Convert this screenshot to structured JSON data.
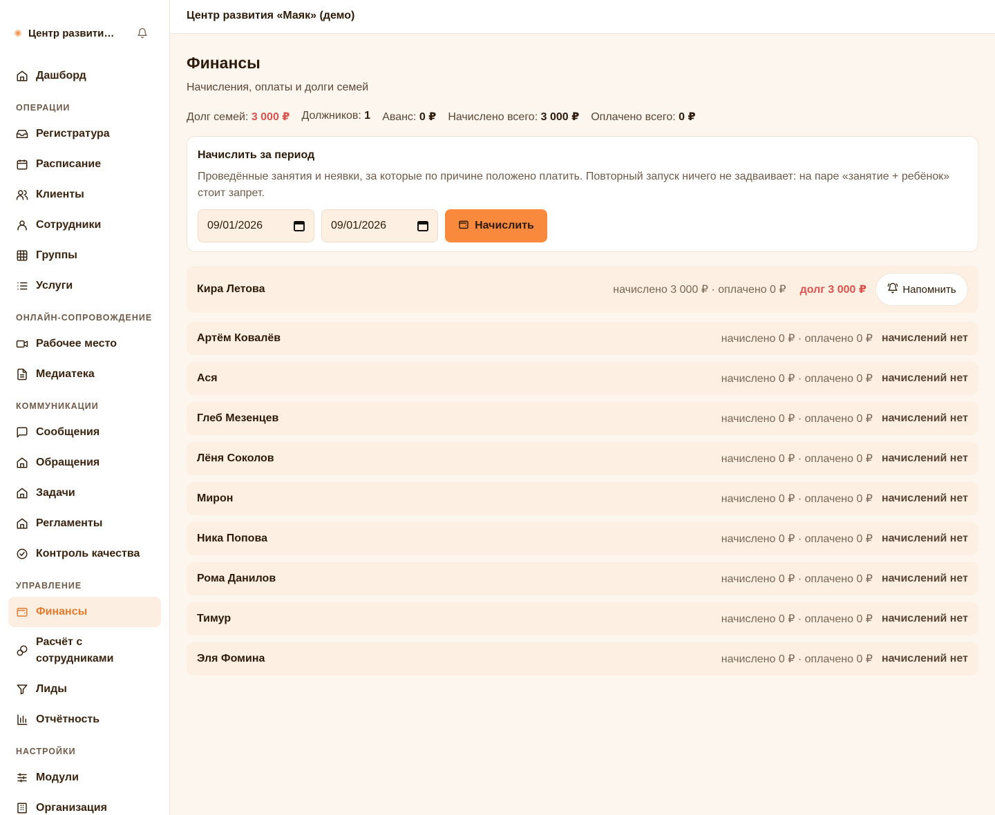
{
  "sidebar": {
    "brand": "Центр развития «Маяк» (демо)",
    "top_item": "Дашборд",
    "sections": {
      "operations": "ОПЕРАЦИИ",
      "online": "ОНЛАЙН-СОПРОВОЖДЕНИЕ",
      "communications": "КОММУНИКАЦИИ",
      "management": "УПРАВЛЕНИЕ",
      "settings": "НАСТРОЙКИ"
    },
    "items": {
      "registry": "Регистратура",
      "schedule": "Расписание",
      "clients": "Клиенты",
      "staff": "Сотрудники",
      "groups": "Группы",
      "services": "Услуги",
      "workplace": "Рабочее место",
      "media": "Медиатека",
      "messages": "Сообщения",
      "requests": "Обращения",
      "tasks": "Задачи",
      "regulations": "Регламенты",
      "quality": "Контроль качества",
      "finance": "Финансы",
      "payroll_line1": "Расчёт с",
      "payroll_line2": "сотрудниками",
      "leads": "Лиды",
      "reports": "Отчётность",
      "modules": "Модули",
      "organization": "Организация"
    }
  },
  "topbar": {
    "title": "Центр развития «Маяк» (демо)"
  },
  "page": {
    "title": "Финансы",
    "subtitle": "Начисления, оплаты и долги семей"
  },
  "stats": {
    "debt_label": "Долг семей:",
    "debt_value": "3 000 ₽",
    "debtors_label": "Должников:",
    "debtors_value": "1",
    "advance_label": "Аванс:",
    "advance_value": "0 ₽",
    "accrued_label": "Начислено всего:",
    "accrued_value": "3 000 ₽",
    "paid_label": "Оплачено всего:",
    "paid_value": "0 ₽"
  },
  "accrual": {
    "title": "Начислить за период",
    "description": "Проведённые занятия и неявки, за которые по причине положено платить. Повторный запуск ничего не задваивает: на паре «занятие + ребёнок» стоит запрет.",
    "date_from": "09/01/2026",
    "date_to": "09/01/2026",
    "button": "Начислить"
  },
  "families": [
    {
      "name": "Кира Летова",
      "amounts": "начислено 3 000 ₽ · оплачено 0 ₽",
      "status": "долг 3 000 ₽",
      "action": "Напомнить"
    },
    {
      "name": "Артём Ковалёв",
      "amounts": "начислено 0 ₽ · оплачено 0 ₽",
      "status": "начислений нет"
    },
    {
      "name": "Ася",
      "amounts": "начислено 0 ₽ · оплачено 0 ₽",
      "status": "начислений нет"
    },
    {
      "name": "Глеб Мезенцев",
      "amounts": "начислено 0 ₽ · оплачено 0 ₽",
      "status": "начислений нет"
    },
    {
      "name": "Лёня Соколов",
      "amounts": "начислено 0 ₽ · оплачено 0 ₽",
      "status": "начислений нет"
    },
    {
      "name": "Мирон",
      "amounts": "начислено 0 ₽ · оплачено 0 ₽",
      "status": "начислений нет"
    },
    {
      "name": "Ника Попова",
      "amounts": "начислено 0 ₽ · оплачено 0 ₽",
      "status": "начислений нет"
    },
    {
      "name": "Рома Данилов",
      "amounts": "начислено 0 ₽ · оплачено 0 ₽",
      "status": "начислений нет"
    },
    {
      "name": "Тимур",
      "amounts": "начислено 0 ₽ · оплачено 0 ₽",
      "status": "начислений нет"
    },
    {
      "name": "Эля Фомина",
      "amounts": "начислено 0 ₽ · оплачено 0 ₽",
      "status": "начислений нет"
    }
  ],
  "colors": {
    "accent": "#f98a3d",
    "active_text": "#e27b2d",
    "debt": "#d9534f",
    "row_bg": "#fdf0e3"
  }
}
